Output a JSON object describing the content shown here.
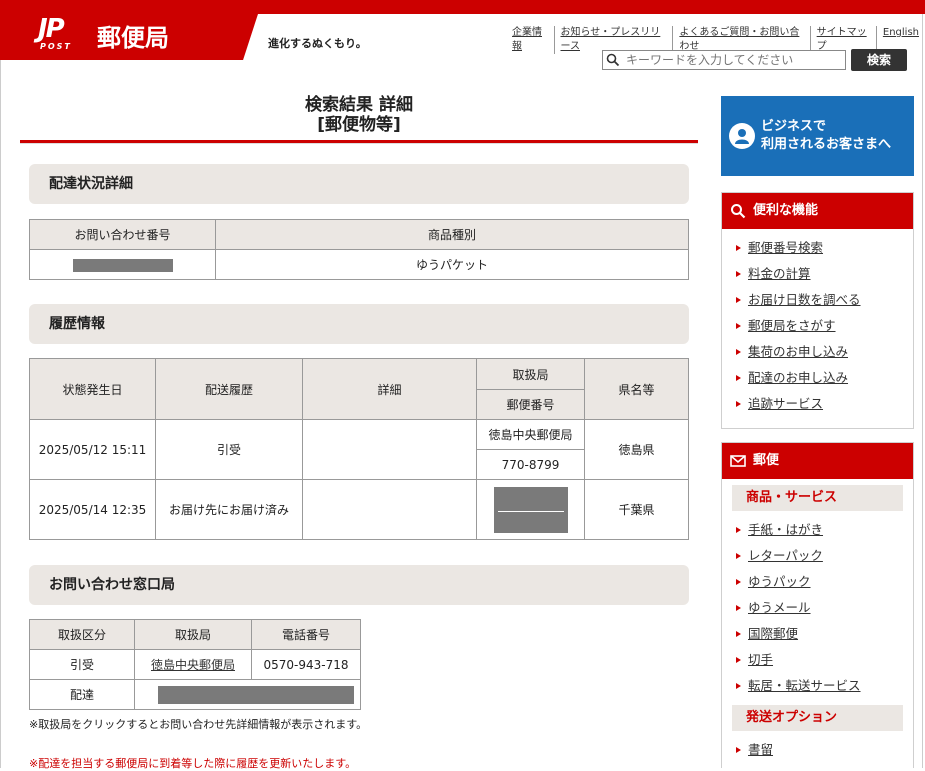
{
  "header": {
    "brand": "郵便局",
    "logo_jp": "JP",
    "logo_post": "POST",
    "tagline": "進化するぬくもり。",
    "utility_links": [
      "企業情報",
      "お知らせ・プレスリリース",
      "よくあるご質問・お問い合わせ",
      "サイトマップ",
      "English"
    ],
    "search_placeholder": "キーワードを入力してください",
    "search_button": "検索"
  },
  "main": {
    "title_line1": "検索結果 詳細",
    "title_line2": "[郵便物等]",
    "delivery_detail": {
      "heading": "配達状況詳細",
      "col_inquiry_number": "お問い合わせ番号",
      "col_item_type": "商品種別",
      "item_type": "ゆうパケット"
    },
    "history": {
      "heading": "履歴情報",
      "col_date": "状態発生日",
      "col_status": "配送履歴",
      "col_detail": "詳細",
      "col_office": "取扱局",
      "col_postal": "郵便番号",
      "col_prefecture": "県名等",
      "rows": [
        {
          "date": "2025/05/12 15:11",
          "status": "引受",
          "detail": "",
          "office": "徳島中央郵便局",
          "postal": "770-8799",
          "prefecture": "徳島県"
        },
        {
          "date": "2025/05/14 12:35",
          "status": "お届け先にお届け済み",
          "detail": "",
          "office": "",
          "postal": "",
          "prefecture": "千葉県"
        }
      ]
    },
    "contact": {
      "heading": "お問い合わせ窓口局",
      "col_type": "取扱区分",
      "col_office": "取扱局",
      "col_phone": "電話番号",
      "rows": [
        {
          "type": "引受",
          "office": "徳島中央郵便局",
          "phone": "0570-943-718"
        },
        {
          "type": "配達",
          "office": "",
          "phone": ""
        }
      ]
    },
    "note1": "※取扱局をクリックするとお問い合わせ先詳細情報が表示されます。",
    "note2": "※配達を担当する郵便局に到着等した際に履歴を更新いたします。"
  },
  "sidebar": {
    "business_banner": "ビジネスで\n利用されるお客さまへ",
    "features": {
      "heading": "便利な機能",
      "items": [
        "郵便番号検索",
        "料金の計算",
        "お届け日数を調べる",
        "郵便局をさがす",
        "集荷のお申し込み",
        "配達のお申し込み",
        "追跡サービス"
      ]
    },
    "mail": {
      "heading": "郵便",
      "sub1": "商品・サービス",
      "items": [
        "手紙・はがき",
        "レターパック",
        "ゆうパック",
        "ゆうメール",
        "国際郵便",
        "切手",
        "転居・転送サービス"
      ],
      "sub2": "発送オプション",
      "items2": [
        "書留"
      ]
    }
  },
  "colors": {
    "brand_red": "#cc0000",
    "business_blue": "#1a6fb8",
    "section_bg": "#ebe7e3"
  }
}
